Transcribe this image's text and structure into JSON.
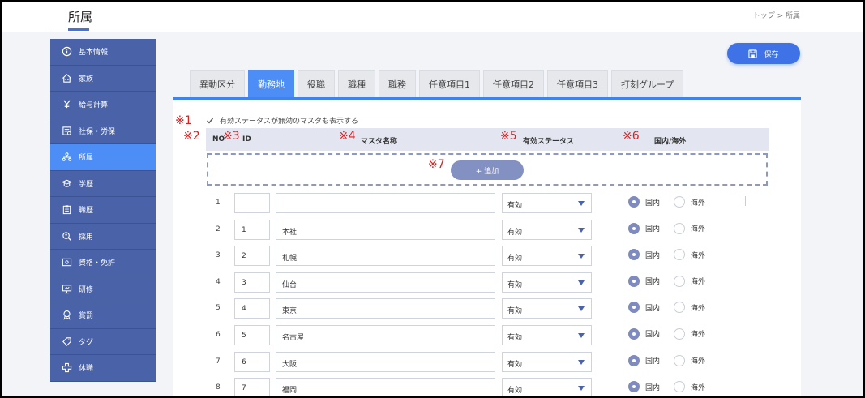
{
  "header": {
    "title": "所属",
    "breadcrumb": "トップ > 所属"
  },
  "sidebar": {
    "items": [
      {
        "label": "基本情報",
        "icon": "info-icon",
        "active": false
      },
      {
        "label": "家族",
        "icon": "family-house-icon",
        "active": false
      },
      {
        "label": "給与計算",
        "icon": "yen-icon",
        "active": false
      },
      {
        "label": "社保・労保",
        "icon": "insurance-icon",
        "active": false
      },
      {
        "label": "所属",
        "icon": "org-chart-icon",
        "active": true
      },
      {
        "label": "学歴",
        "icon": "graduation-cap-icon",
        "active": false
      },
      {
        "label": "職歴",
        "icon": "clipboard-icon",
        "active": false
      },
      {
        "label": "採用",
        "icon": "recruit-search-icon",
        "active": false
      },
      {
        "label": "資格・免許",
        "icon": "certificate-icon",
        "active": false
      },
      {
        "label": "研修",
        "icon": "presentation-icon",
        "active": false
      },
      {
        "label": "賞罰",
        "icon": "medal-icon",
        "active": false
      },
      {
        "label": "タグ",
        "icon": "tag-icon",
        "active": false
      },
      {
        "label": "休職",
        "icon": "medical-cross-icon",
        "active": false
      }
    ]
  },
  "toolbar": {
    "save_label": "保存"
  },
  "tabs": [
    {
      "label": "異動区分",
      "active": false
    },
    {
      "label": "勤務地",
      "active": true
    },
    {
      "label": "役職",
      "active": false
    },
    {
      "label": "職種",
      "active": false
    },
    {
      "label": "職務",
      "active": false
    },
    {
      "label": "任意項目1",
      "active": false
    },
    {
      "label": "任意項目2",
      "active": false
    },
    {
      "label": "任意項目3",
      "active": false
    },
    {
      "label": "打刻グループ",
      "active": false
    }
  ],
  "notes": [
    "※1",
    "※2",
    "※3",
    "※4",
    "※5",
    "※6",
    "※7"
  ],
  "filter": {
    "show_inactive_label": "有効ステータスが無効のマスタも表示する",
    "checked": true
  },
  "table": {
    "headers": {
      "no": "NO",
      "id": "ID",
      "name": "マスタ名称",
      "status": "有効ステータス",
      "region": "国内/海外"
    },
    "add_label": "+ 追加",
    "radio_domestic": "国内",
    "radio_overseas": "海外",
    "rows": [
      {
        "no": "1",
        "id": "",
        "name": "",
        "status": "有効",
        "region": "国内"
      },
      {
        "no": "2",
        "id": "1",
        "name": "本社",
        "status": "有効",
        "region": "国内"
      },
      {
        "no": "3",
        "id": "2",
        "name": "札幌",
        "status": "有効",
        "region": "国内"
      },
      {
        "no": "4",
        "id": "3",
        "name": "仙台",
        "status": "有効",
        "region": "国内"
      },
      {
        "no": "5",
        "id": "4",
        "name": "東京",
        "status": "有効",
        "region": "国内"
      },
      {
        "no": "6",
        "id": "5",
        "name": "名古屋",
        "status": "有効",
        "region": "国内"
      },
      {
        "no": "7",
        "id": "6",
        "name": "大阪",
        "status": "有効",
        "region": "国内"
      },
      {
        "no": "8",
        "id": "7",
        "name": "福岡",
        "status": "有効",
        "region": "国内"
      }
    ]
  },
  "colors": {
    "accent": "#3f72e6",
    "sidebar": "#4a63a8",
    "sidebar_active": "#4c8ef5",
    "note": "#e02020"
  }
}
